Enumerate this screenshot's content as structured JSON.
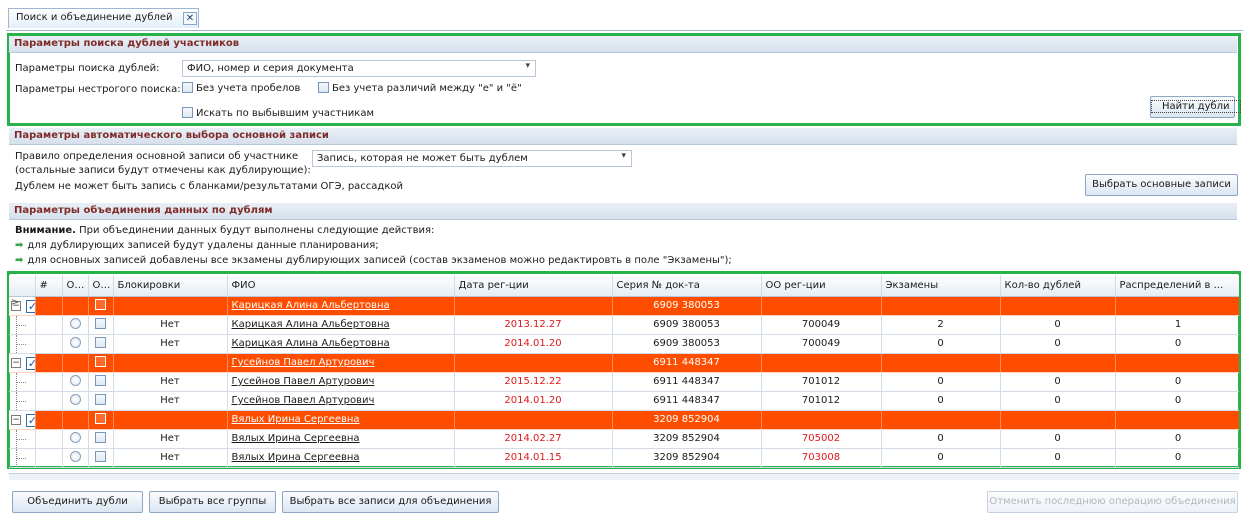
{
  "tab": {
    "title": "Поиск и объединение дублей",
    "close": "✕"
  },
  "search": {
    "header": "Параметры поиска дублей участников",
    "params_label": "Параметры поиска дублей:",
    "params_value": "ФИО, номер и серия документа",
    "fuzzy_label": "Параметры нестрогого поиска:",
    "cb_spaces": "Без учета пробелов",
    "cb_e": "Без учета различий между \"е\" и \"ё\"",
    "cb_dropped": "Искать по выбывшим участникам",
    "find_btn": "Найти дубли"
  },
  "auto": {
    "header": "Параметры автоматического выбора основной записи",
    "rule_line1": "Правило определения основной записи об участнике",
    "rule_line2": "(остальные записи будут отмечены как дублирующие):",
    "rule_value": "Запись, которая не может быть дублем",
    "note": "Дублем не может быть запись с бланками/результатами ОГЭ, рассадкой",
    "select_btn": "Выбрать основные записи"
  },
  "merge": {
    "header": "Параметры объединения данных по дублям",
    "warning_bold": "Внимание.",
    "warning_text": " При объединении данных будут выполнены следующие действия:",
    "item1": "для дублирующих записей будут удалены данные планирования;",
    "item2": "для основных записей добавлены все экзамены дублирующих записей (состав экзаменов можно редактировть в поле \"Экзамены\");"
  },
  "grid": {
    "columns": [
      "#",
      "О...",
      "О...",
      "Блокировки",
      "ФИО",
      "Дата рег-ции",
      "Серия № док-та",
      "ОО рег-ции",
      "Экзамены",
      "Кол-во дублей",
      "Распределений в ..."
    ],
    "groups": [
      {
        "fio": "Карицкая Алина Альбертовна",
        "doc": "6909 380053",
        "rows": [
          {
            "block": "Нет",
            "fio": "Карицкая Алина Альбертовна",
            "date": "2013.12.27",
            "doc": "6909 380053",
            "oo": "700049",
            "oo_red": false,
            "exams": "2",
            "dups": "0",
            "dist": "1"
          },
          {
            "block": "Нет",
            "fio": "Карицкая Алина Альбертовна",
            "date": "2014.01.20",
            "doc": "6909 380053",
            "oo": "700049",
            "oo_red": false,
            "exams": "0",
            "dups": "0",
            "dist": "0"
          }
        ]
      },
      {
        "fio": "Гусейнов Павел Артурович",
        "doc": "6911 448347",
        "rows": [
          {
            "block": "Нет",
            "fio": "Гусейнов Павел Артурович",
            "date": "2015.12.22",
            "doc": "6911 448347",
            "oo": "701012",
            "oo_red": false,
            "exams": "0",
            "dups": "0",
            "dist": "0"
          },
          {
            "block": "Нет",
            "fio": "Гусейнов Павел Артурович",
            "date": "2014.01.20",
            "doc": "6911 448347",
            "oo": "701012",
            "oo_red": false,
            "exams": "0",
            "dups": "0",
            "dist": "0"
          }
        ]
      },
      {
        "fio": "Вялых Ирина Сергеевна",
        "doc": "3209 852904",
        "rows": [
          {
            "block": "Нет",
            "fio": "Вялых Ирина Сергеевна",
            "date": "2014.02.27",
            "doc": "3209 852904",
            "oo": "705002",
            "oo_red": true,
            "exams": "0",
            "dups": "0",
            "dist": "0"
          },
          {
            "block": "Нет",
            "fio": "Вялых Ирина Сергеевна",
            "date": "2014.01.15",
            "doc": "3209 852904",
            "oo": "703008",
            "oo_red": true,
            "exams": "0",
            "dups": "0",
            "dist": "0"
          }
        ]
      }
    ]
  },
  "footer": {
    "merge_btn": "Объединить дубли",
    "select_groups_btn": "Выбрать все группы",
    "select_records_btn": "Выбрать все записи для объединения",
    "undo_btn": "Отменить последнюю операцию объединения"
  }
}
